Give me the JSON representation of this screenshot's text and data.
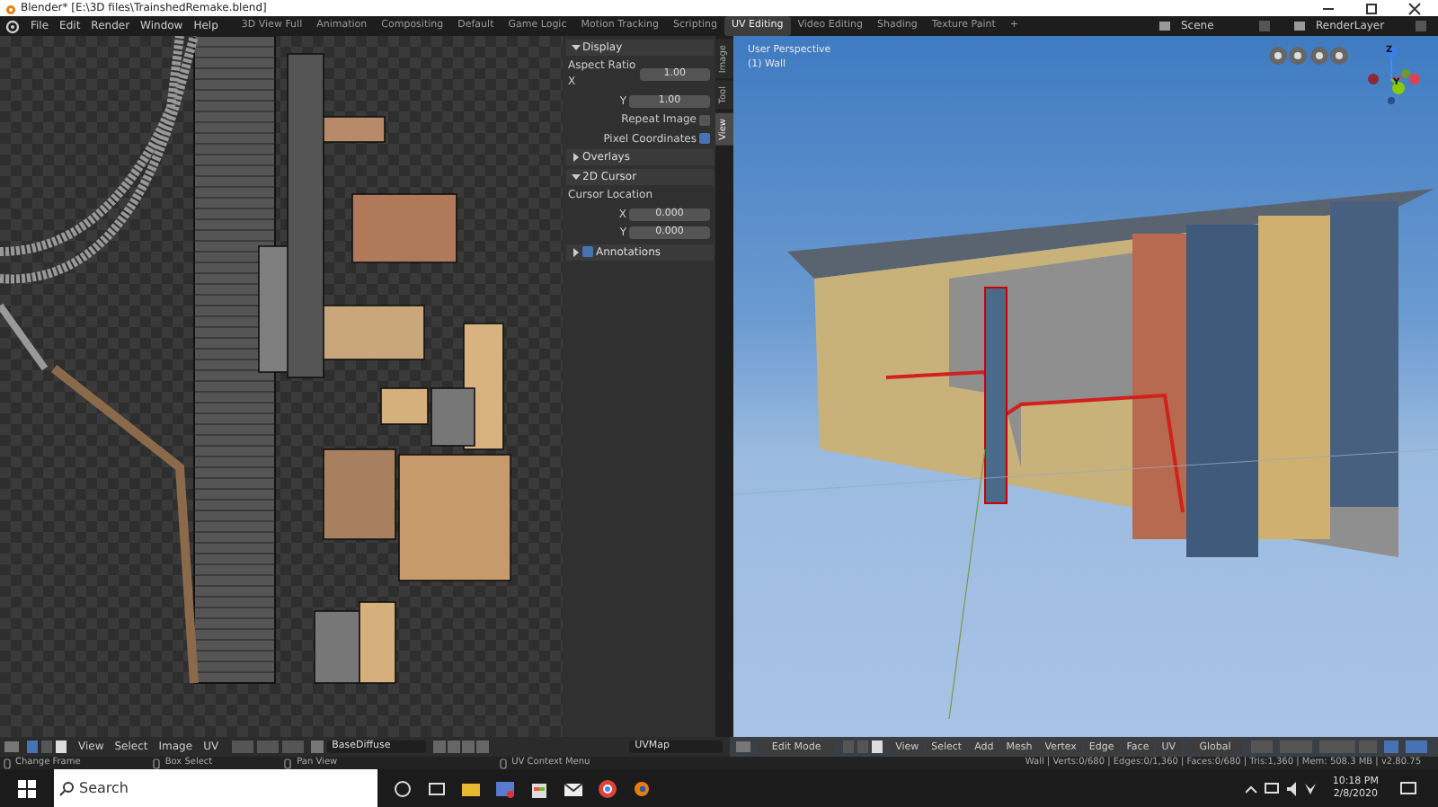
{
  "window": {
    "title": "Blender* [E:\\3D files\\TrainshedRemake.blend]"
  },
  "menu": [
    "File",
    "Edit",
    "Render",
    "Window",
    "Help"
  ],
  "workspaces": [
    {
      "label": "3D View Full",
      "selected": false
    },
    {
      "label": "Animation",
      "selected": false
    },
    {
      "label": "Compositing",
      "selected": false
    },
    {
      "label": "Default",
      "selected": false
    },
    {
      "label": "Game Logic",
      "selected": false
    },
    {
      "label": "Motion Tracking",
      "selected": false
    },
    {
      "label": "Scripting",
      "selected": false
    },
    {
      "label": "UV Editing",
      "selected": true
    },
    {
      "label": "Video Editing",
      "selected": false
    },
    {
      "label": "Shading",
      "selected": false
    },
    {
      "label": "Texture Paint",
      "selected": false
    }
  ],
  "add_workspace": "+",
  "scene": "Scene",
  "view_layer": "RenderLayer",
  "sidebar": {
    "tabs": [
      {
        "label": "Image",
        "selected": false
      },
      {
        "label": "Tool",
        "selected": false
      },
      {
        "label": "View",
        "selected": true
      }
    ],
    "panels": [
      {
        "title": "Display",
        "expanded": true,
        "fields": [
          {
            "kind": "number",
            "label": "Aspect Ratio X",
            "value": "1.00"
          },
          {
            "kind": "number",
            "label": "Y",
            "value": "1.00"
          },
          {
            "kind": "checkbox",
            "label": "Repeat Image",
            "checked": false
          },
          {
            "kind": "checkbox",
            "label": "Pixel Coordinates",
            "checked": true
          }
        ]
      },
      {
        "title": "Overlays",
        "expanded": false
      },
      {
        "title": "2D Cursor",
        "expanded": true,
        "fields": [
          {
            "kind": "heading",
            "label": "Cursor Location"
          },
          {
            "kind": "number",
            "label": "X",
            "value": "0.000"
          },
          {
            "kind": "number",
            "label": "Y",
            "value": "0.000"
          }
        ]
      },
      {
        "title": "Annotations",
        "expanded": false,
        "checked": true
      }
    ]
  },
  "viewport": {
    "view_name": "User Perspective",
    "object_label": "(1) Wall",
    "gizmo_labels": [
      "Z",
      "Y"
    ]
  },
  "uv_header": {
    "menus": [
      "View",
      "Select",
      "Image",
      "UV"
    ],
    "image_name": "BaseDiffuse",
    "uv_map": "UVMap"
  },
  "viewport_header": {
    "mode": "Edit Mode",
    "menus": [
      "View",
      "Select",
      "Add",
      "Mesh",
      "Vertex",
      "Edge",
      "Face",
      "UV"
    ],
    "transform": "Global"
  },
  "status_bar": {
    "hints": [
      "Change Frame",
      "Box Select",
      "Pan View",
      "UV Context Menu"
    ],
    "stats": "Wall | Verts:0/680 | Edges:0/1,360 | Faces:0/680 | Tris:1,360 | Mem: 508.3 MB | v2.80.75"
  },
  "taskbar": {
    "search": "Search",
    "time": "10:18 PM",
    "date": "2/8/2020"
  }
}
